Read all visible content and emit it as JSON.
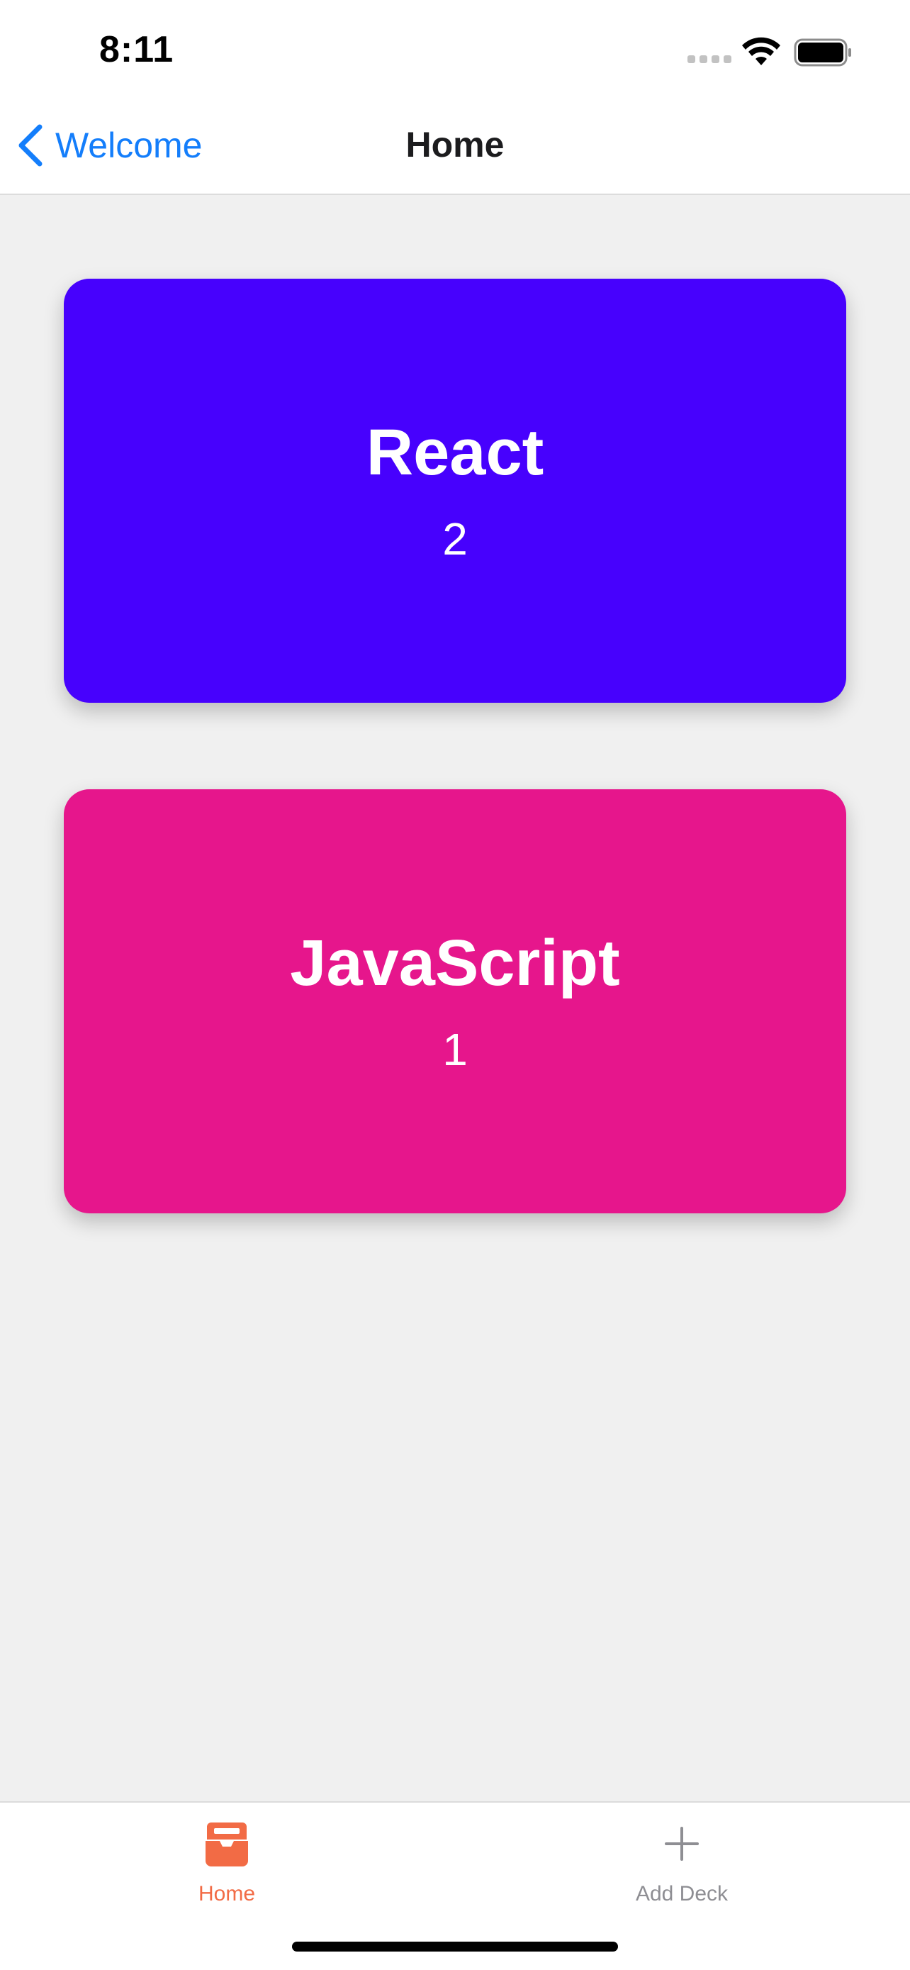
{
  "status_bar": {
    "time": "8:11"
  },
  "nav": {
    "back_label": "Welcome",
    "title": "Home"
  },
  "decks": [
    {
      "title": "React",
      "count": "2",
      "color": "#4701fd"
    },
    {
      "title": "JavaScript",
      "count": "1",
      "color": "#e6168c"
    }
  ],
  "tabs": [
    {
      "label": "Home",
      "icon": "inbox-icon",
      "active": true,
      "color": "#f26b45"
    },
    {
      "label": "Add Deck",
      "icon": "plus-icon",
      "active": false,
      "color": "#8e8e93"
    }
  ],
  "colors": {
    "accent": "#147efb",
    "background": "#f0f0f0"
  }
}
